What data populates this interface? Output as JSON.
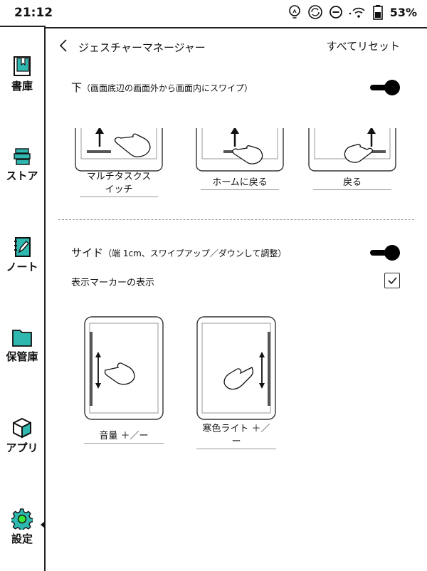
{
  "status": {
    "time": "21:12",
    "battery": "53%"
  },
  "sidebar": {
    "items": [
      {
        "label": "書庫",
        "icon": "library-icon"
      },
      {
        "label": "ストア",
        "icon": "store-icon"
      },
      {
        "label": "ノート",
        "icon": "notes-icon"
      },
      {
        "label": "保管庫",
        "icon": "folder-icon"
      },
      {
        "label": "アプリ",
        "icon": "apps-icon"
      },
      {
        "label": "設定",
        "icon": "settings-gear-icon",
        "active": true
      }
    ]
  },
  "header": {
    "title": "ジェスチャーマネージャー",
    "reset": "すべてリセット"
  },
  "bottom_section": {
    "title": "下",
    "subtitle": "（画面底辺の画面外から画面内にスワイプ）",
    "enabled": true,
    "options": [
      {
        "label_line1": "マルチタスクス",
        "label_line2": "イッチ"
      },
      {
        "label_line1": "ホームに戻る"
      },
      {
        "label_line1": "戻る"
      }
    ]
  },
  "side_section": {
    "title": "サイド",
    "subtitle": "（端 1cm、スワイプアップ／ダウンして調整）",
    "enabled": true,
    "marker_label": "表示マーカーの表示",
    "marker_checked": true,
    "options": [
      {
        "label_line1": "音量 ＋／ー"
      },
      {
        "label_line1": "寒色ライト ＋／",
        "label_line2": "ー"
      }
    ]
  },
  "colors": {
    "accent_active": "#39e639",
    "ink": "#111111"
  }
}
